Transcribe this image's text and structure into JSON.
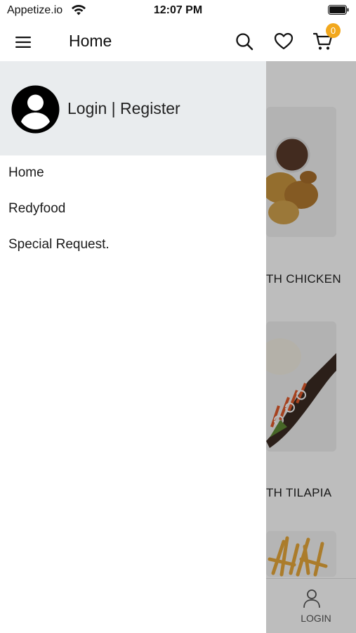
{
  "status_bar": {
    "carrier": "Appetize.io",
    "time": "12:07 PM"
  },
  "app_bar": {
    "title": "Home",
    "cart_count": "0"
  },
  "drawer": {
    "login_label": "Login | Register",
    "items": [
      {
        "label": "Home"
      },
      {
        "label": "Redyfood"
      },
      {
        "label": "Special Request."
      }
    ]
  },
  "background": {
    "captions": [
      "TH CHICKEN",
      "TH TILAPIA"
    ],
    "bottom_tab_label": "LOGIN"
  },
  "colors": {
    "badge": "#f2a81d",
    "drawer_header": "#e9ecee"
  },
  "icons": [
    "wifi-icon",
    "battery-icon",
    "menu-icon",
    "search-icon",
    "heart-icon",
    "cart-icon",
    "account-circle-icon",
    "person-icon"
  ]
}
